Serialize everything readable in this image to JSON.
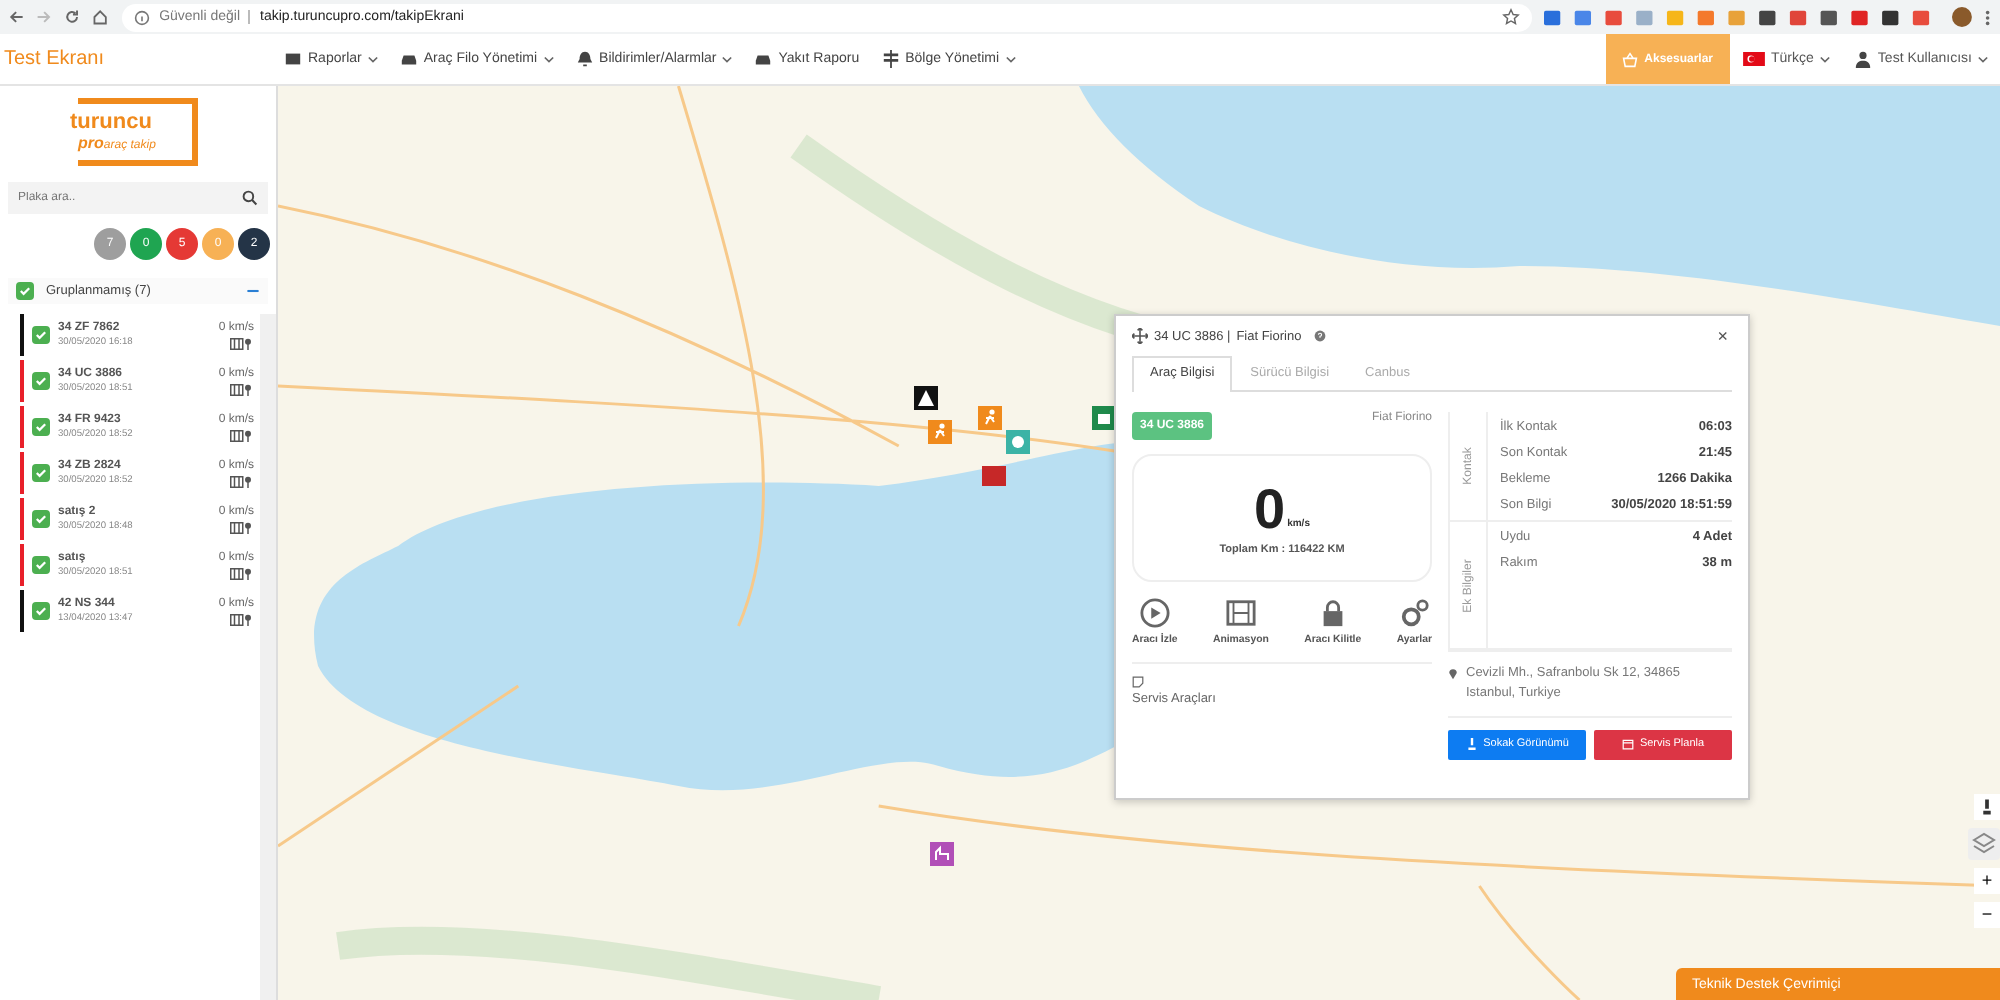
{
  "browser": {
    "security": "Güvenli değil",
    "url": "takip.turuncupro.com/takipEkrani"
  },
  "nav": {
    "title": "Test Ekranı",
    "menu": [
      {
        "label": "Raporlar",
        "dropdown": true
      },
      {
        "label": "Araç Filo Yönetimi",
        "dropdown": true
      },
      {
        "label": "Bildirimler/Alarmlar",
        "dropdown": true
      },
      {
        "label": "Yakıt Raporu",
        "dropdown": false
      },
      {
        "label": "Bölge Yönetimi",
        "dropdown": true
      }
    ],
    "accessories": "Aksesuarlar",
    "language": "Türkçe",
    "user": "Test Kullanıcısı"
  },
  "sidebar": {
    "logo_top": "turuncu",
    "logo_pro": "pro",
    "logo_sub": "araç takip",
    "search": {
      "placeholder": "Plaka ara.."
    },
    "counters": [
      {
        "value": "7",
        "color": "#9e9e9e"
      },
      {
        "value": "0",
        "color": "#1fa551"
      },
      {
        "value": "5",
        "color": "#e53935"
      },
      {
        "value": "0",
        "color": "#f7b155"
      },
      {
        "value": "2",
        "color": "#243447"
      }
    ],
    "group": {
      "label": "Gruplanmamış (7)",
      "checked": true,
      "expanded": true
    },
    "vehicles": [
      {
        "plate": "34 ZF 7862",
        "time": "30/05/2020 16:18",
        "speed": "0 km/s",
        "color": "#111111",
        "checked": true
      },
      {
        "plate": "34 UC 3886",
        "time": "30/05/2020 18:51",
        "speed": "0 km/s",
        "color": "#e8202a",
        "checked": true
      },
      {
        "plate": "34 FR 9423",
        "time": "30/05/2020 18:52",
        "speed": "0 km/s",
        "color": "#e8202a",
        "checked": true
      },
      {
        "plate": "34 ZB 2824",
        "time": "30/05/2020 18:52",
        "speed": "0 km/s",
        "color": "#e8202a",
        "checked": true
      },
      {
        "plate": "satış 2",
        "time": "30/05/2020 18:48",
        "speed": "0 km/s",
        "color": "#e8202a",
        "checked": true
      },
      {
        "plate": "satış",
        "time": "30/05/2020 18:51",
        "speed": "0 km/s",
        "color": "#e8202a",
        "checked": true
      },
      {
        "plate": "42 NS 344",
        "time": "13/04/2020 13:47",
        "speed": "0 km/s",
        "color": "#111111",
        "checked": true
      }
    ]
  },
  "popup": {
    "plate": "34 UC 3886 |",
    "model": "Fiat Fiorino",
    "close": "×",
    "tabs": [
      {
        "label": "Araç Bilgisi",
        "selected": true
      },
      {
        "label": "Sürücü Bilgisi",
        "selected": false
      },
      {
        "label": "Canbus",
        "selected": false
      }
    ],
    "plate_badge": "34 UC 3886",
    "model_label": "Fiat Fiorino",
    "speed": "0",
    "speed_unit": "km/s",
    "total_km": "Toplam Km : 116422 KM",
    "actions": [
      "Aracı İzle",
      "Animasyon",
      "Aracı Kilitle",
      "Ayarlar"
    ],
    "sections": [
      {
        "title": "Kontak",
        "rows": [
          {
            "label": "İlk Kontak",
            "value": "06:03"
          },
          {
            "label": "Son Kontak",
            "value": "21:45"
          },
          {
            "label": "Bekleme",
            "value": "1266 Dakika"
          },
          {
            "label": "Son Bilgi",
            "value": "30/05/2020 18:51:59"
          }
        ]
      },
      {
        "title": "Ek Bilgiler",
        "rows": [
          {
            "label": "Uydu",
            "value": "4 Adet"
          },
          {
            "label": "Rakım",
            "value": "38 m"
          }
        ]
      }
    ],
    "address": "Cevizli Mh., Safranbolu Sk 12, 34865 Istanbul, Turkiye",
    "services": "Servis Araçları",
    "buttons": [
      "Sokak Görünümü",
      "Servis Planla"
    ]
  },
  "map_controls": {
    "zoom_in": "+",
    "zoom_out": "−"
  },
  "support": "Teknik Destek Çevrimiçi"
}
